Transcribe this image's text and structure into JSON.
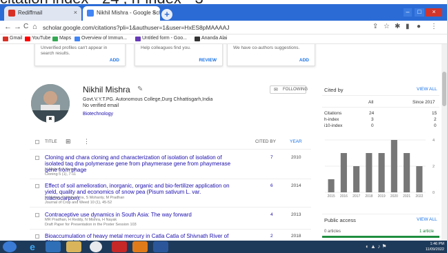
{
  "overlay_text": "citation index - 24 , h-index - 3",
  "browser": {
    "tabs": [
      {
        "label": "Rediffmail",
        "close": "×"
      },
      {
        "label": "Nikhil Mishra - Google Scholar",
        "close": "×"
      }
    ],
    "newtab_label": "+",
    "window_controls": {
      "minimize": "–",
      "maximize": "□",
      "close": "×"
    },
    "url": "scholar.google.com/citations?pli=1&authuser=1&user=HxES8pMAAAAJ",
    "nav": {
      "back": "←",
      "forward": "→",
      "reload": "C",
      "home": "⌂",
      "lock": "🔒"
    },
    "bookmarks": [
      {
        "label": "Gmail",
        "color": "#d93025"
      },
      {
        "label": "YouTube",
        "color": "#ff0000"
      },
      {
        "label": "Maps",
        "color": "#34a853"
      },
      {
        "label": "Overview of Immun...",
        "color": "#4285f4"
      },
      {
        "label": "Untitled form - Goo...",
        "color": "#673ab7"
      },
      {
        "label": "Ananda Alai",
        "color": "#333333"
      }
    ]
  },
  "suggestion_cards": [
    {
      "text": "Unverified profiles can't appear in search results.",
      "action": "ADD"
    },
    {
      "text": "Help colleagues find you.",
      "action": "REVIEW"
    },
    {
      "text": "We have co-authors suggestions.",
      "action": "ADD"
    }
  ],
  "profile": {
    "name": "Nikhil Mishra",
    "edit_icon": "✎",
    "affiliation": "Govt.V.Y.T.PG. Autonomous College,Durg Chhattisgarh,India",
    "email_status": "No verified email",
    "interest": "Biotechnology",
    "follow_label": "FOLLOWING"
  },
  "table": {
    "header_title": "TITLE",
    "header_cited": "CITED BY",
    "header_year": "YEAR",
    "articles": [
      {
        "title": "Cloning and chara cloning and characterization of isolation of isolation of isolated taq dna polymerase gene from phaymerase gene from phaymerase gene from phage",
        "authors": "N Mishra, A Kumar",
        "venue": "Cloning 5 (1), 7-11",
        "cited_by": "7",
        "year": "2010"
      },
      {
        "title": "Effect of soil amelioration, inorganic, organic and bio-fertilizer application on yield, quality and economics of snow pea (Pisum sativum L. var. macrocarpon).",
        "authors": "N Mishra, P Mahapatra, S Mohanty, M Pradhan",
        "venue": "Journal of Crop and Weed 10 (1), 45-52",
        "cited_by": "6",
        "year": "2014"
      },
      {
        "title": "Contraceptive use dynamics in South Asia: The way forward",
        "authors": "MR Pradhan, H Reddy, N Mishra, H Nayak",
        "venue": "Draft Paper for Presentation in the Poster Session 103",
        "cited_by": "4",
        "year": "2013"
      },
      {
        "title": "Bioaccumulation of heavy metal mercury in Catla Catla of Shivnath River of Chhattisgarh, India",
        "authors": "",
        "venue": "",
        "cited_by": "2",
        "year": "2018"
      }
    ]
  },
  "cited_by": {
    "title": "Cited by",
    "view_all": "VIEW ALL",
    "col_all": "All",
    "col_since": "Since 2017",
    "rows": [
      {
        "label": "Citations",
        "all": "24",
        "since": "15"
      },
      {
        "label": "h-index",
        "all": "3",
        "since": "2"
      },
      {
        "label": "i10-index",
        "all": "0",
        "since": "0"
      }
    ]
  },
  "chart_data": {
    "type": "bar",
    "categories": [
      "2015",
      "2016",
      "2017",
      "2018",
      "2019",
      "2020",
      "2021",
      "2022"
    ],
    "values": [
      1,
      3,
      2,
      3,
      3,
      4,
      3,
      2
    ],
    "ylim": [
      0,
      4
    ],
    "yticks": [
      "4",
      "2",
      "0"
    ],
    "bar_color": "#777777"
  },
  "public_access": {
    "title": "Public access",
    "view_all": "VIEW ALL",
    "not_available": "0 articles",
    "available": "1 article"
  },
  "taskbar": {
    "time": "1:46 PM",
    "date": "11/09/2022"
  }
}
